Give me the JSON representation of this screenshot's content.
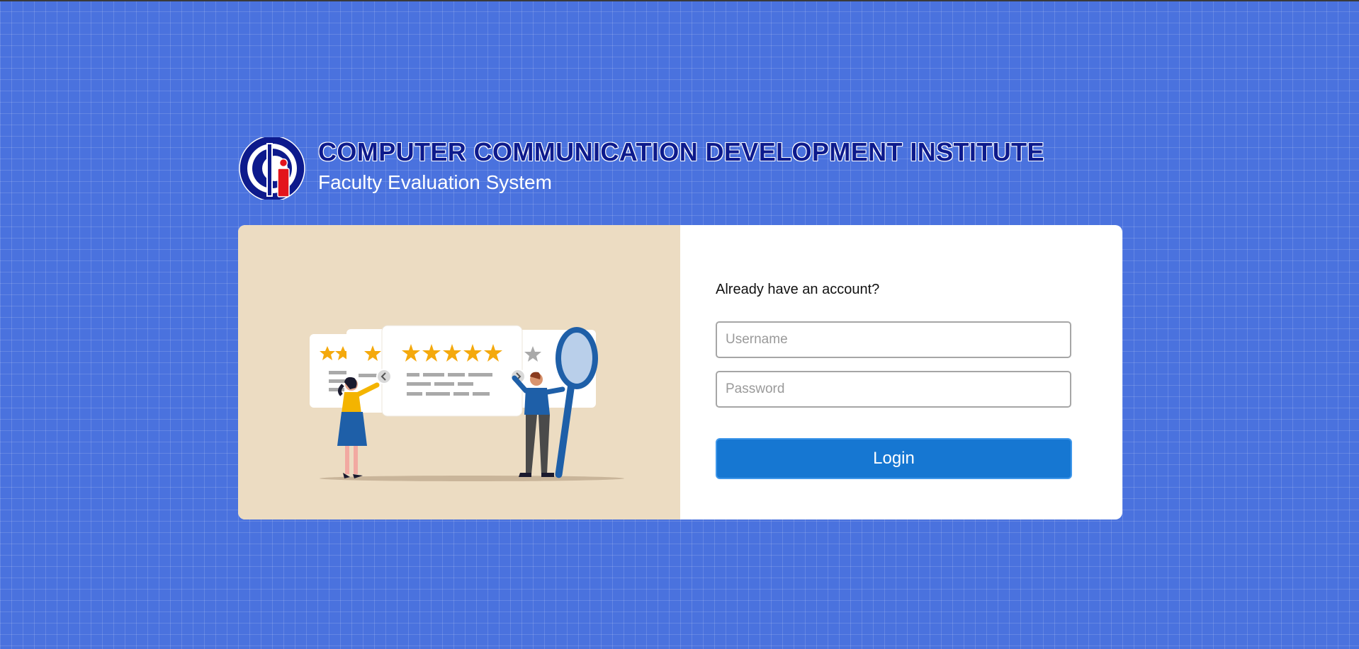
{
  "header": {
    "institute_name": "COMPUTER COMMUNICATION DEVELOPMENT INSTITUTE",
    "system_name": "Faculty Evaluation System",
    "logo_letter": "i"
  },
  "login": {
    "prompt": "Already have an account?",
    "username_placeholder": "Username",
    "password_placeholder": "Password",
    "button_label": "Login"
  },
  "illustration": {
    "rating_stars_main": 5,
    "subject": "review-rating-illustration"
  },
  "colors": {
    "page_background": "#4a72de",
    "institute_name": "#0d1a8c",
    "logo": "#0d1a8c",
    "logo_accent": "#e3141c",
    "button": "#1677d2",
    "illustration_background": "#ecdcc2",
    "star": "#f4a90d"
  }
}
